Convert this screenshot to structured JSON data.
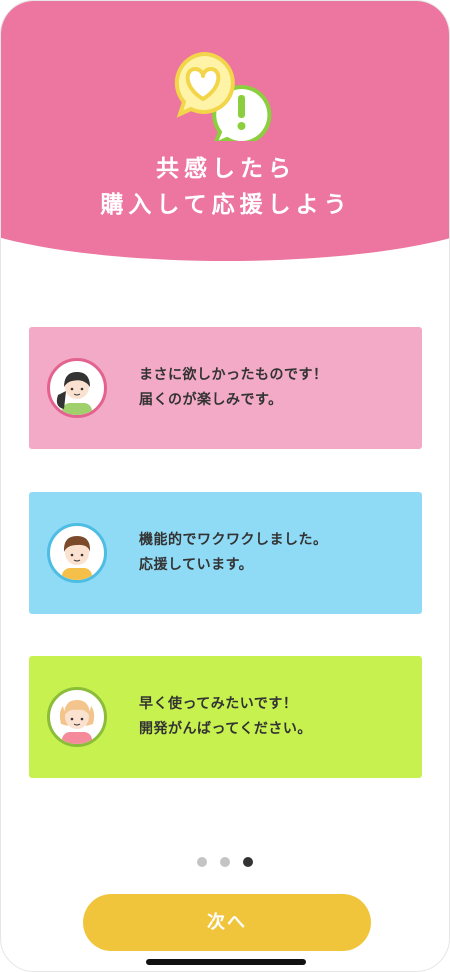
{
  "colors": {
    "hero": "#ec769f",
    "card_pink": "#f2aac6",
    "card_blue": "#8fdaf5",
    "card_green": "#c7f14f",
    "button": "#f0c53c"
  },
  "hero": {
    "icon_left": "heart-bubble-icon",
    "icon_right": "exclamation-bubble-icon",
    "title_line1": "共感したら",
    "title_line2": "購入して応援しよう"
  },
  "testimonials": [
    {
      "avatar": "girl-avatar",
      "line1": "まさに欲しかったものです！",
      "line2": "届くのが楽しみです。"
    },
    {
      "avatar": "boy-avatar",
      "line1": "機能的でワクワクしました。",
      "line2": "応援しています。"
    },
    {
      "avatar": "blonde-girl-avatar",
      "line1": "早く使ってみたいです！",
      "line2": "開発がんばってください。"
    }
  ],
  "pagination": {
    "current_page": 3,
    "total_pages": 3
  },
  "next_button": {
    "label": "次へ"
  }
}
